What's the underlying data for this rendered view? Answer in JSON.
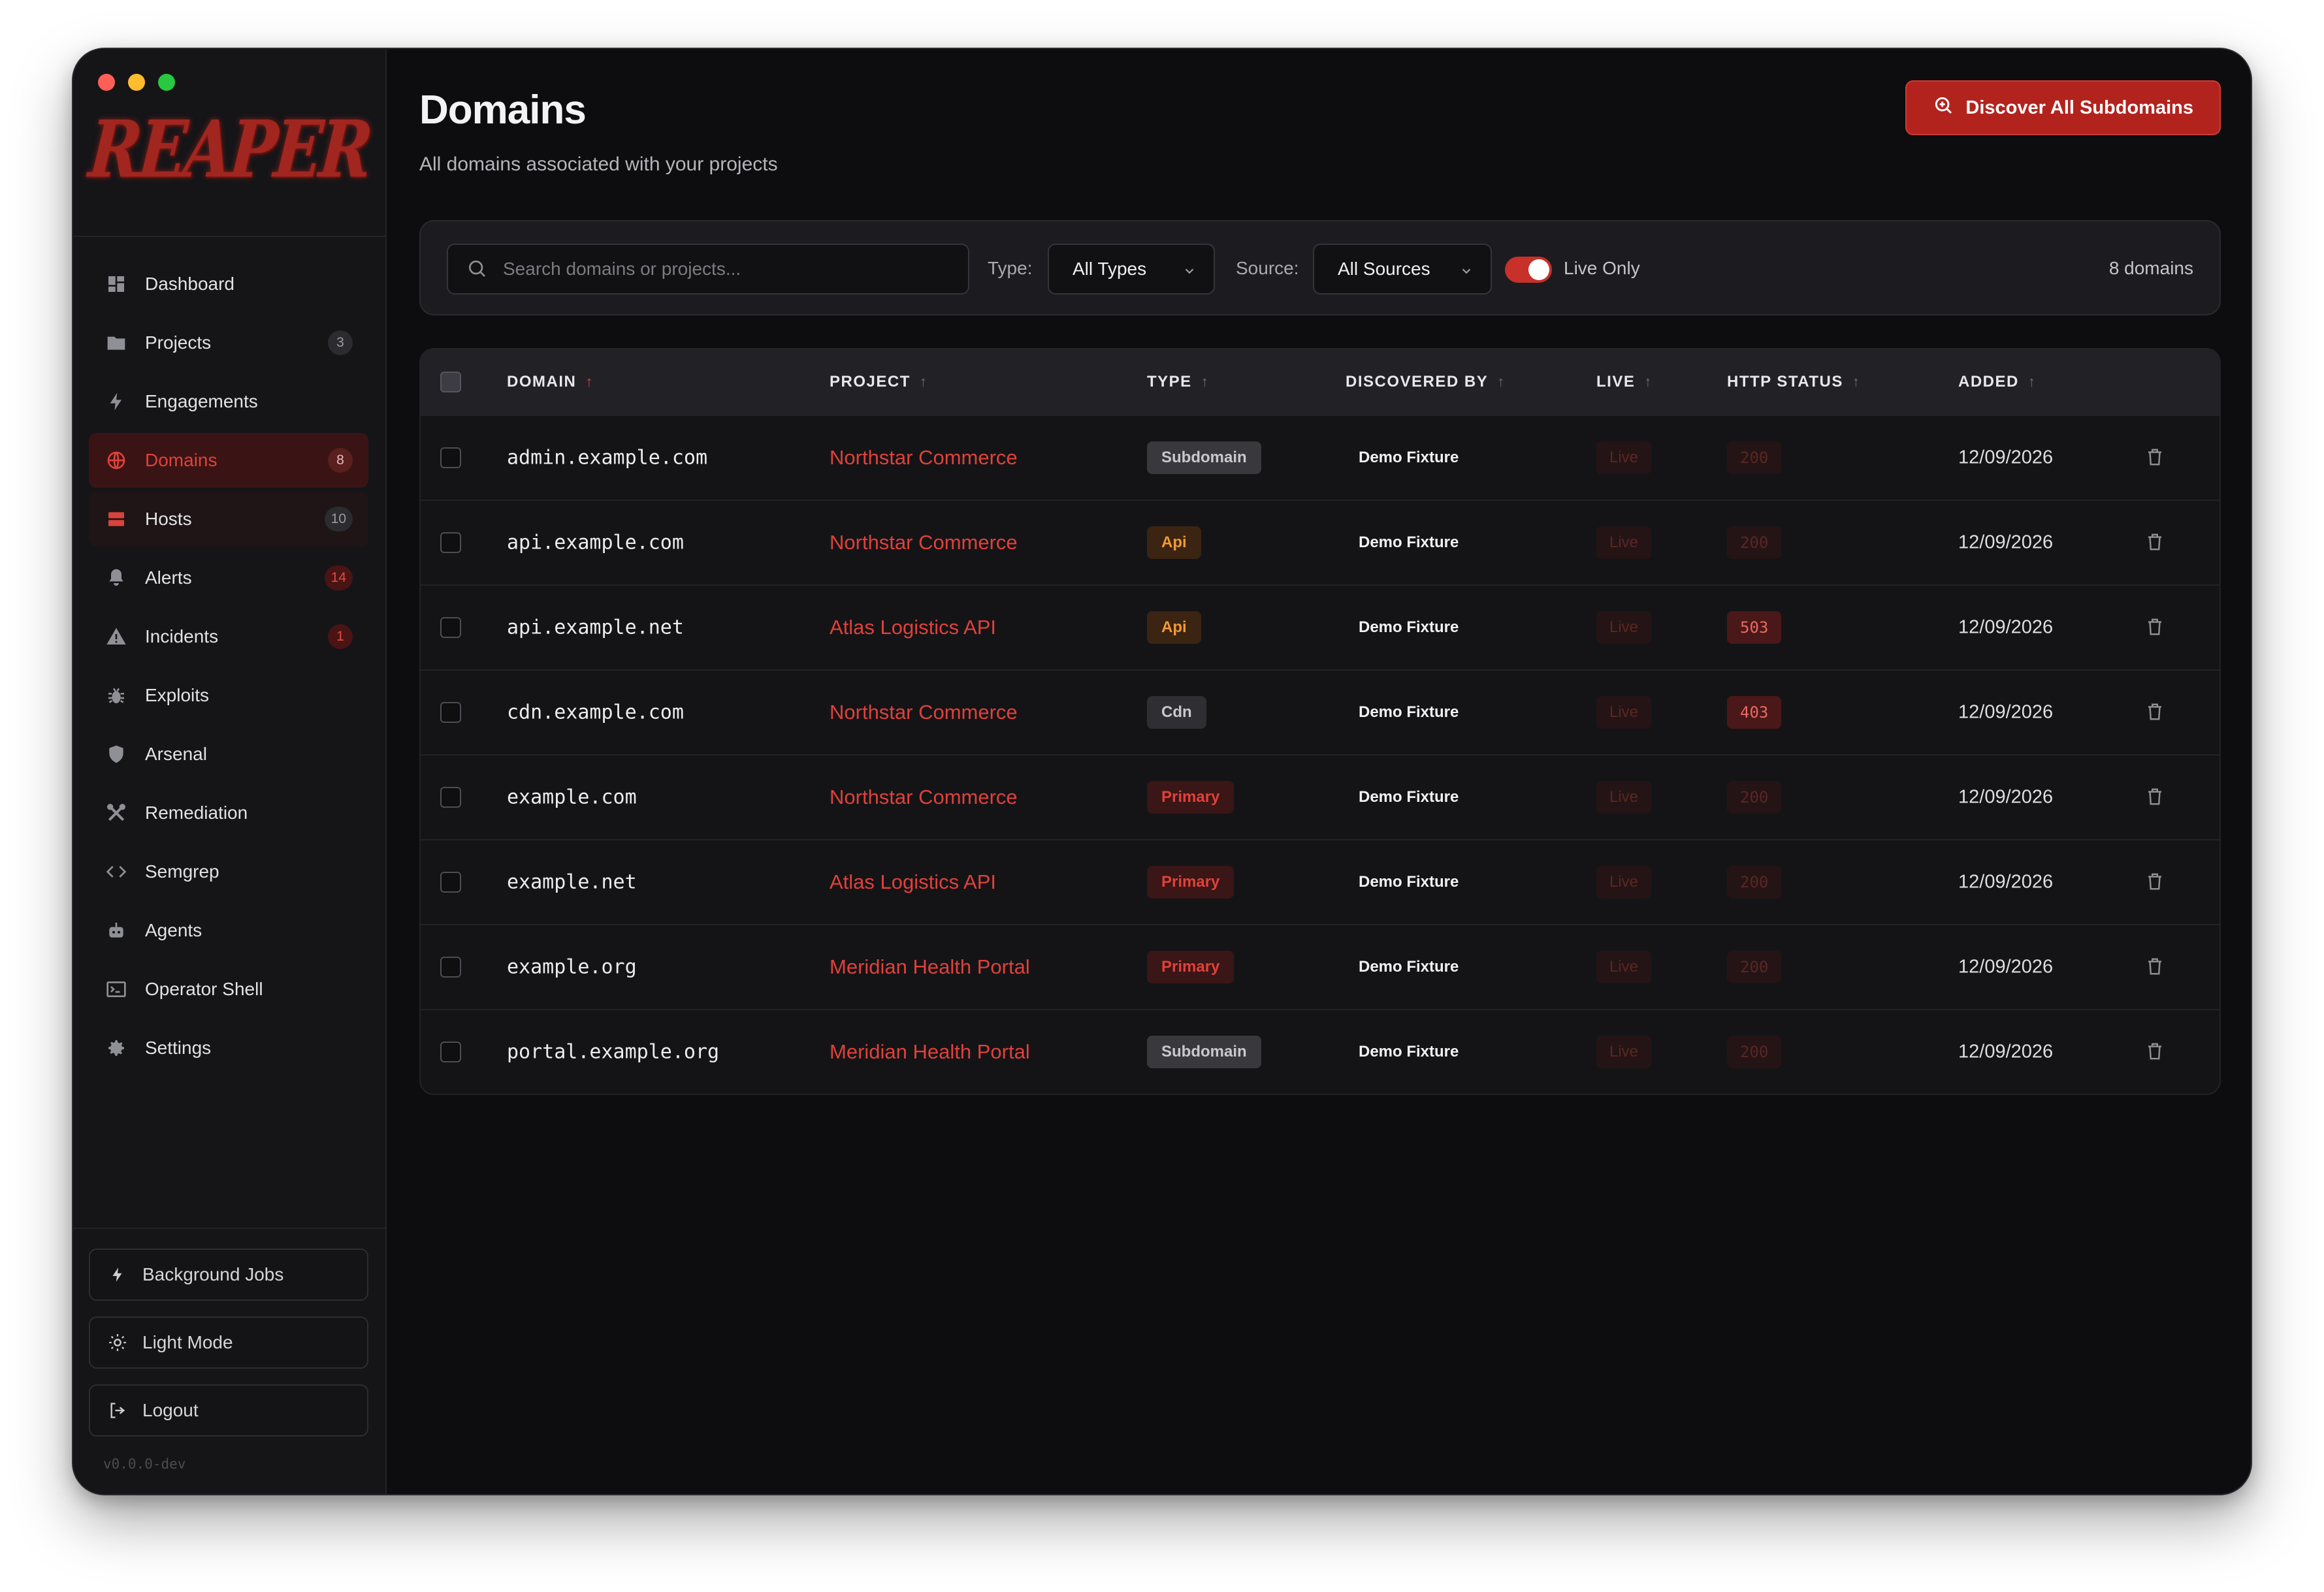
{
  "app": {
    "logo_text": "REAPER",
    "version": "v0.0.0-dev"
  },
  "sidebar": {
    "items": [
      {
        "label": "Dashboard",
        "icon": "dashboard-icon",
        "badge": ""
      },
      {
        "label": "Projects",
        "icon": "folder-icon",
        "badge": "3"
      },
      {
        "label": "Engagements",
        "icon": "bolt-icon",
        "badge": ""
      },
      {
        "label": "Domains",
        "icon": "globe-icon",
        "badge": "8",
        "active": true
      },
      {
        "label": "Hosts",
        "icon": "server-icon",
        "badge": "10"
      },
      {
        "label": "Alerts",
        "icon": "bell-icon",
        "badge": "14"
      },
      {
        "label": "Incidents",
        "icon": "warning-icon",
        "badge": "1"
      },
      {
        "label": "Exploits",
        "icon": "bug-icon",
        "badge": ""
      },
      {
        "label": "Arsenal",
        "icon": "shield-icon",
        "badge": ""
      },
      {
        "label": "Remediation",
        "icon": "tools-icon",
        "badge": ""
      },
      {
        "label": "Semgrep",
        "icon": "code-icon",
        "badge": ""
      },
      {
        "label": "Agents",
        "icon": "robot-icon",
        "badge": ""
      },
      {
        "label": "Operator Shell",
        "icon": "terminal-icon",
        "badge": ""
      },
      {
        "label": "Settings",
        "icon": "gear-icon",
        "badge": ""
      }
    ],
    "bottom": {
      "jobs": "Background Jobs",
      "theme": "Light Mode",
      "logout": "Logout"
    }
  },
  "header": {
    "title": "Domains",
    "subtitle": "All domains associated with your projects",
    "discover_button": "Discover All Subdomains"
  },
  "filters": {
    "search_placeholder": "Search domains or projects...",
    "type_label": "Type:",
    "type_value": "All Types",
    "source_label": "Source:",
    "source_value": "All Sources",
    "live_only_label": "Live Only",
    "live_only": true,
    "count": "8 domains"
  },
  "table": {
    "columns": [
      "DOMAIN",
      "PROJECT",
      "TYPE",
      "DISCOVERED BY",
      "LIVE",
      "HTTP STATUS",
      "ADDED"
    ],
    "rows": [
      {
        "domain": "admin.example.com",
        "project": "Northstar Commerce",
        "type": "Subdomain",
        "discovered_by": "Demo Fixture",
        "live": "Live",
        "status": "200",
        "added": "12/09/2026"
      },
      {
        "domain": "api.example.com",
        "project": "Northstar Commerce",
        "type": "Api",
        "discovered_by": "Demo Fixture",
        "live": "Live",
        "status": "200",
        "added": "12/09/2026"
      },
      {
        "domain": "api.example.net",
        "project": "Atlas Logistics API",
        "type": "Api",
        "discovered_by": "Demo Fixture",
        "live": "Live",
        "status": "503",
        "added": "12/09/2026"
      },
      {
        "domain": "cdn.example.com",
        "project": "Northstar Commerce",
        "type": "Cdn",
        "discovered_by": "Demo Fixture",
        "live": "Live",
        "status": "403",
        "added": "12/09/2026"
      },
      {
        "domain": "example.com",
        "project": "Northstar Commerce",
        "type": "Primary",
        "discovered_by": "Demo Fixture",
        "live": "Live",
        "status": "200",
        "added": "12/09/2026"
      },
      {
        "domain": "example.net",
        "project": "Atlas Logistics API",
        "type": "Primary",
        "discovered_by": "Demo Fixture",
        "live": "Live",
        "status": "200",
        "added": "12/09/2026"
      },
      {
        "domain": "example.org",
        "project": "Meridian Health Portal",
        "type": "Primary",
        "discovered_by": "Demo Fixture",
        "live": "Live",
        "status": "200",
        "added": "12/09/2026"
      },
      {
        "domain": "portal.example.org",
        "project": "Meridian Health Portal",
        "type": "Subdomain",
        "discovered_by": "Demo Fixture",
        "live": "Live",
        "status": "200",
        "added": "12/09/2026"
      }
    ]
  },
  "colors": {
    "accent": "#e0413a",
    "button": "#b3231e",
    "background": "#0d0d10",
    "sidebar": "#151518"
  }
}
